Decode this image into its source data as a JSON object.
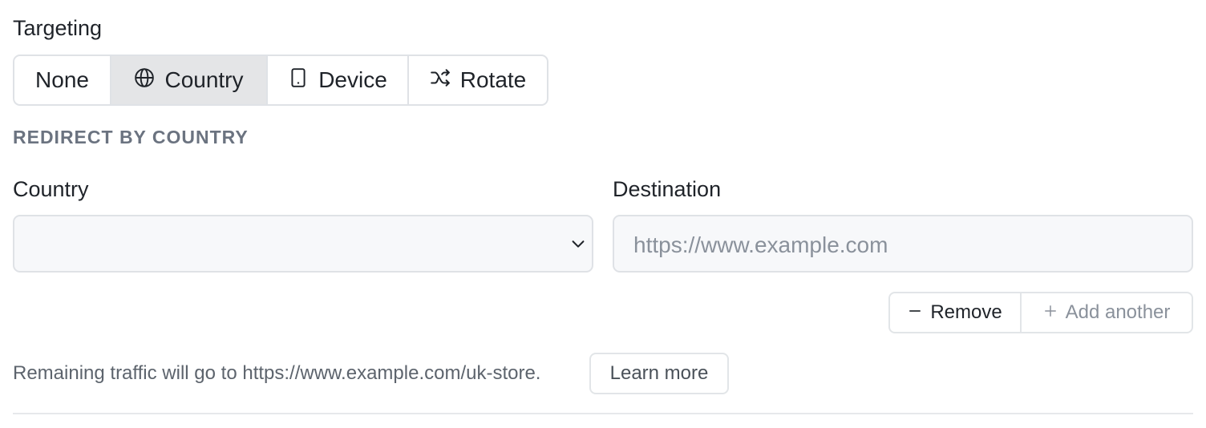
{
  "targeting": {
    "label": "Targeting",
    "options": [
      {
        "label": "None",
        "icon": null,
        "active": false
      },
      {
        "label": "Country",
        "icon": "globe-icon",
        "active": true
      },
      {
        "label": "Device",
        "icon": "phone-icon",
        "active": false
      },
      {
        "label": "Rotate",
        "icon": "shuffle-icon",
        "active": false
      }
    ]
  },
  "section_title": "REDIRECT BY COUNTRY",
  "country": {
    "label": "Country",
    "value": "",
    "icon": "chevron-down-icon"
  },
  "destination": {
    "label": "Destination",
    "placeholder": "https://www.example.com"
  },
  "actions": {
    "remove_label": "Remove",
    "add_label": "Add another"
  },
  "footer": {
    "note": "Remaining traffic will go to https://www.example.com/uk-store.",
    "learn_more": "Learn more"
  },
  "colors": {
    "active_bg": "#e4e5e7",
    "border": "#dfe2e6",
    "muted": "#6b7380"
  }
}
